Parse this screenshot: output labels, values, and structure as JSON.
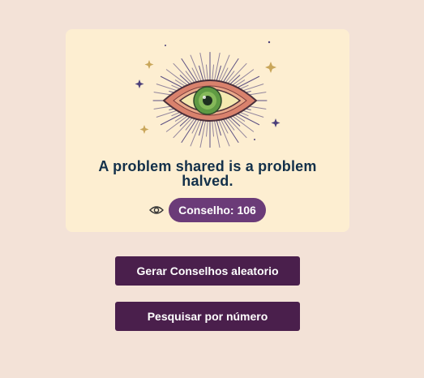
{
  "advice": {
    "text": "A problem shared is a problem halved.",
    "counter_label": "Conselho: 106"
  },
  "illustration": {
    "icon": "mystic-eye-icon",
    "view_icon": "eye-icon"
  },
  "buttons": {
    "random_label": "Gerar Conselhos aleatorio",
    "search_label": "Pesquisar por número"
  },
  "colors": {
    "background": "#f3e2d7",
    "card": "#fdeed1",
    "badge": "#6b3b78",
    "button": "#4a1f4c",
    "text": "#13304a"
  }
}
